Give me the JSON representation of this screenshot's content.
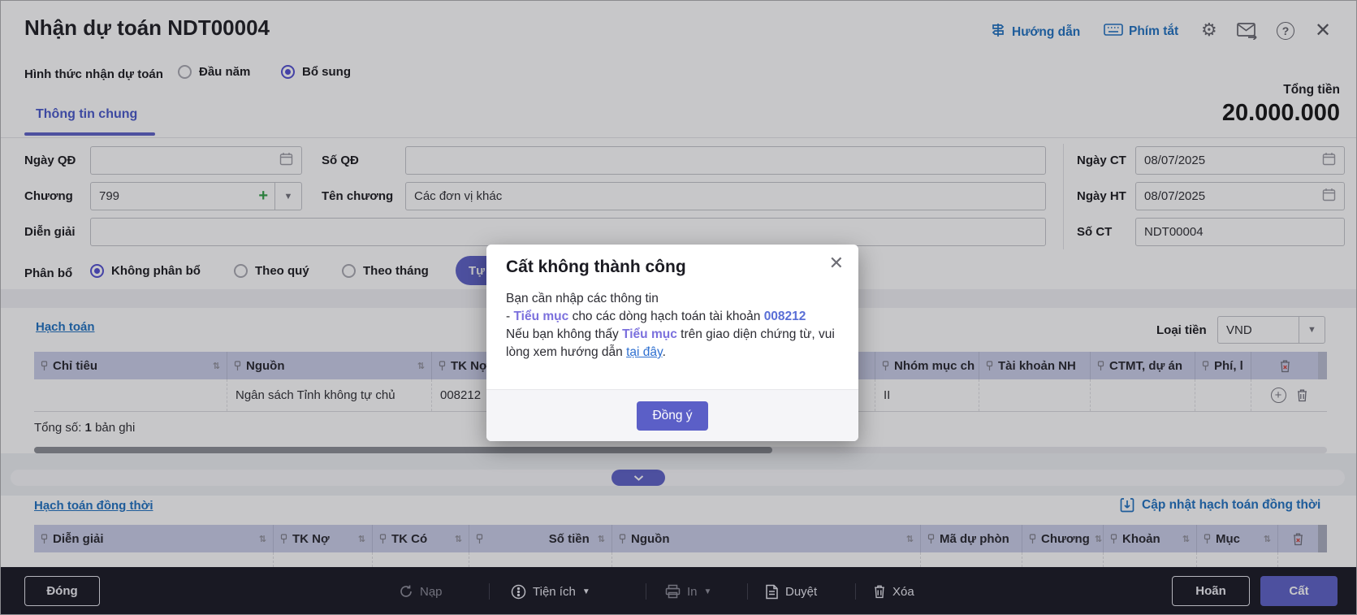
{
  "header": {
    "title": "Nhận dự toán NDT00004",
    "guide_link": "Hướng dẫn",
    "shortcut_link": "Phím tắt"
  },
  "form_type": {
    "label": "Hình thức nhận dự toán",
    "opt_dau_nam": "Đầu năm",
    "opt_bo_sung": "Bổ sung"
  },
  "tab": {
    "label": "Thông tin chung"
  },
  "total": {
    "label": "Tổng tiền",
    "value": "20.000.000"
  },
  "fields": {
    "ngay_qd": {
      "label": "Ngày QĐ",
      "value": ""
    },
    "so_qd": {
      "label": "Số QĐ",
      "value": ""
    },
    "chuong": {
      "label": "Chương",
      "value": "799"
    },
    "ten_chuong": {
      "label": "Tên chương",
      "value": "Các đơn vị khác"
    },
    "dien_giai": {
      "label": "Diễn giải",
      "value": ""
    },
    "ngay_ct": {
      "label": "Ngày CT",
      "value": "08/07/2025"
    },
    "ngay_ht": {
      "label": "Ngày HT",
      "value": "08/07/2025"
    },
    "so_ct": {
      "label": "Số CT",
      "value": "NDT00004"
    }
  },
  "phan_bo": {
    "label": "Phân bổ",
    "opt1": "Không phân bổ",
    "opt2": "Theo quý",
    "opt3": "Theo tháng",
    "auto_btn": "Tự"
  },
  "ht": {
    "title": "Hạch toán",
    "currency_label": "Loại tiền",
    "currency": "VND",
    "cols": [
      "Chỉ tiêu",
      "Nguồn",
      "TK Nợ",
      "",
      "Nhóm mục ch",
      "Tài khoản NH",
      "CTMT, dự án",
      "Phí, l"
    ],
    "row": {
      "chi_tieu": "",
      "nguon": "Ngân sách Tỉnh không tự chủ",
      "tk_no": "008212",
      "nhom_muc_chi": "II"
    },
    "total_label": "Tổng số:",
    "total_value": "1",
    "total_unit": "bản ghi"
  },
  "modal": {
    "title": "Cất không thành công",
    "line1": "Bạn cần nhập các thông tin",
    "dash": "-",
    "link_tieu_muc": "Tiểu mục",
    "line2_mid": "cho các dòng hạch toán tài khoản",
    "account": "008212",
    "line3_a": "Nếu bạn không thấy",
    "line3_b": "trên giao diện chứng từ, vui lòng xem hướng dẫn",
    "link_here": "tại đây",
    "period": ".",
    "ok_btn": "Đồng ý"
  },
  "htdt": {
    "title": "Hạch toán đồng thời",
    "update_link": "Cập nhật hạch toán đồng thời",
    "cols": [
      "Diễn giải",
      "TK Nợ",
      "TK Có",
      "Số tiền",
      "Nguồn",
      "Mã dự phòn",
      "Chương",
      "Khoản",
      "Mục"
    ]
  },
  "toolbar": {
    "dong": "Đóng",
    "nap": "Nạp",
    "tien_ich": "Tiện ích",
    "in": "In",
    "duyet": "Duyệt",
    "xoa": "Xóa",
    "hoan": "Hoãn",
    "cat": "Cất"
  },
  "colors": {
    "accent": "#5b5fc7",
    "link": "#1b6fc0",
    "table_header_bg": "#c9cde8"
  }
}
